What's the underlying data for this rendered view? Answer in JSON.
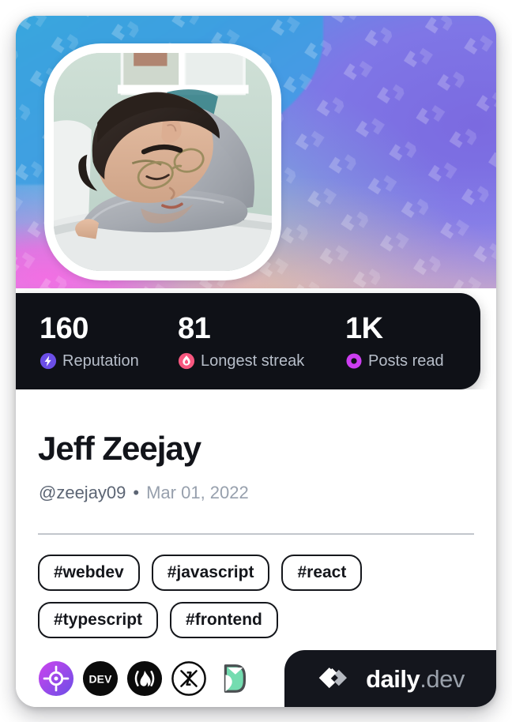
{
  "card": {
    "cover": {
      "pattern_icon": "code-chevron-watermark",
      "gradient_from": "#3aa7dd",
      "gradient_mid": "#7f76e6",
      "gradient_to": "#f05de0"
    },
    "avatar": {
      "alt": "Profile photo of a person asleep with head resting on arms at a desk"
    },
    "stats": [
      {
        "value": "160",
        "label": "Reputation",
        "icon": "reputation-bolt-icon",
        "color": "#6b4ee6"
      },
      {
        "value": "81",
        "label": "Longest streak",
        "icon": "streak-flame-icon",
        "color": "#f8577f"
      },
      {
        "value": "1K",
        "label": "Posts read",
        "icon": "posts-read-ring-icon",
        "color": "#cc3df0"
      }
    ],
    "profile": {
      "name": "Jeff Zeejay",
      "handle": "@zeejay09",
      "separator": "•",
      "joined": "Mar 01, 2022"
    },
    "tags": [
      "#webdev",
      "#javascript",
      "#react",
      "#typescript",
      "#frontend"
    ],
    "badges": [
      {
        "name": "target-crosshair-badge",
        "title": "Crosshair badge"
      },
      {
        "name": "dev-to-badge",
        "title": "DEV",
        "text": "DEV"
      },
      {
        "name": "streak-flame-badge",
        "title": "Flame streak badge"
      },
      {
        "name": "x-circle-badge",
        "title": "X badge"
      },
      {
        "name": "green-d-badge",
        "title": "Green D badge"
      }
    ],
    "brand": {
      "logo": "daily-dev-logo",
      "name": "daily",
      "tld": ".dev"
    }
  }
}
